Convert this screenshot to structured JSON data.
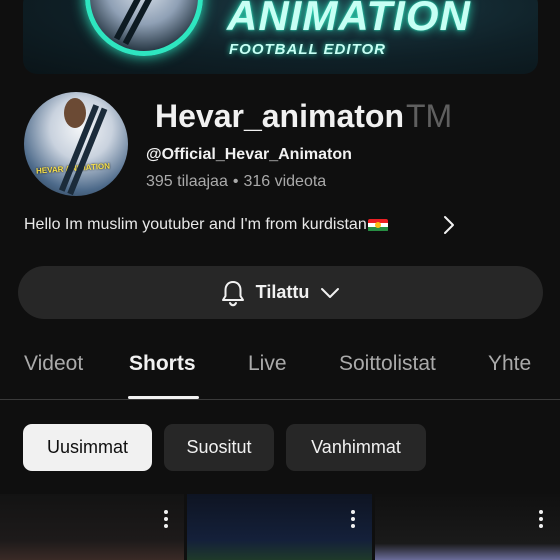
{
  "banner": {
    "title": "ANIMATION",
    "subtitle": "FOOTBALL EDITOR"
  },
  "channel": {
    "name": "Hevar_animaton",
    "trademark": "TM",
    "handle": "@Official_Hevar_Animaton",
    "subscribers": "395 tilaajaa",
    "separator": "•",
    "videos": "316 videota",
    "description": "Hello Im muslim youtuber and I'm from kurdistan",
    "description_flag_icon": "kurdistan-flag-icon"
  },
  "subscribe": {
    "label": "Tilattu",
    "icon": "bell-icon",
    "dropdown_icon": "chevron-down-icon"
  },
  "tabs": [
    {
      "label": "Videot",
      "active": false
    },
    {
      "label": "Shorts",
      "active": true
    },
    {
      "label": "Live",
      "active": false
    },
    {
      "label": "Soittolistat",
      "active": false
    },
    {
      "label": "Yhte",
      "active": false
    }
  ],
  "sort_chips": [
    {
      "label": "Uusimmat",
      "selected": true
    },
    {
      "label": "Suositut",
      "selected": false
    },
    {
      "label": "Vanhimmat",
      "selected": false
    }
  ],
  "colors": {
    "background": "#0f0f0f",
    "surface": "#272727",
    "text_primary": "#f1f1f1",
    "text_secondary": "#aaaaaa",
    "banner_glow": "#2ee6c0",
    "avatar_label": "#f7e04a"
  }
}
